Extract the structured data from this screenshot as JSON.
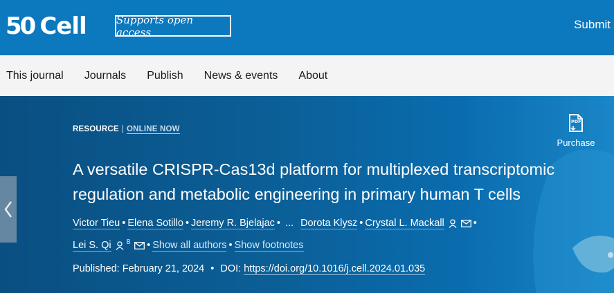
{
  "header": {
    "logo_number": "50",
    "logo_name": "Cell",
    "badge": "Supports open access",
    "submit_label": "Submit"
  },
  "nav": {
    "items": [
      {
        "label": "This journal"
      },
      {
        "label": "Journals"
      },
      {
        "label": "Publish"
      },
      {
        "label": "News & events"
      },
      {
        "label": "About"
      }
    ]
  },
  "article": {
    "type": "RESOURCE",
    "separator": "|",
    "status": "ONLINE NOW",
    "pdf_icon_text": "PDF",
    "purchase_label": "Purchase",
    "title": "A versatile CRISPR-Cas13d platform for multiplexed transcriptomic regulation and metabolic engineering in primary human T cells",
    "authors": [
      "Victor Tieu",
      "Elena Sotillo",
      "Jeremy R. Bjelajac",
      "Dorota Klysz",
      "Crystal L. Mackall",
      "Lei S. Qi"
    ],
    "ellipsis": "...",
    "author_sup": "8",
    "show_all_authors": "Show all authors",
    "show_footnotes": "Show footnotes",
    "published_label": "Published:",
    "published_date": "February 21, 2024",
    "doi_label": "DOI:",
    "doi_url": "https://doi.org/10.1016/j.cell.2024.01.035"
  },
  "icons": {
    "prev": "chevron-left-icon",
    "person": "person-icon",
    "mail": "mail-icon",
    "pdf": "pdf-icon"
  },
  "colors": {
    "topbar": "#0c78bd",
    "nav_bg": "#f4f4f4",
    "hero": "#0b5e96"
  }
}
